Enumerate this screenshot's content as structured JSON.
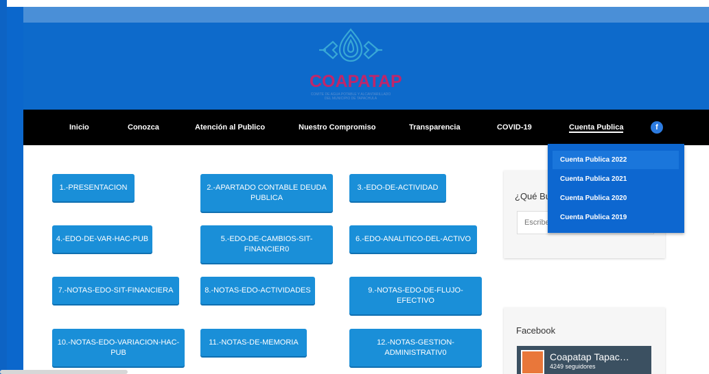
{
  "header": {
    "logo_title": "COAPATAP",
    "logo_subtitle": "COMITE DE AGUA POTABLE Y ALCANTARILLADO DEL MUNICIPIO DE TAPACHULA"
  },
  "nav": {
    "items": [
      {
        "label": "Inicio"
      },
      {
        "label": "Conozca"
      },
      {
        "label": "Atención al Publico"
      },
      {
        "label": "Nuestro Compromiso"
      },
      {
        "label": "Transparencia"
      },
      {
        "label": "COVID-19"
      },
      {
        "label": "Cuenta Publica"
      }
    ],
    "facebook_icon": "f"
  },
  "dropdown": {
    "items": [
      {
        "label": "Cuenta Publica 2022"
      },
      {
        "label": "Cuenta Publica 2021"
      },
      {
        "label": "Cuenta Publica 2020"
      },
      {
        "label": "Cuenta Publica 2019"
      }
    ]
  },
  "buttons": [
    {
      "label": "1.-PRESENTACION"
    },
    {
      "label": "2.-APARTADO CONTABLE DEUDA PUBLICA"
    },
    {
      "label": "3.-EDO-DE-ACTIVIDAD"
    },
    {
      "label": "4.-EDO-DE-VAR-HAC-PUB"
    },
    {
      "label": "5.-EDO-DE-CAMBIOS-SIT-FINANCIER0"
    },
    {
      "label": "6.-EDO-ANALITICO-DEL-ACTIVO"
    },
    {
      "label": "7.-NOTAS-EDO-SIT-FINANCIERA"
    },
    {
      "label": "8.-NOTAS-EDO-ACTIVIDADES"
    },
    {
      "label": "9.-NOTAS-EDO-DE-FLUJO-EFECTIVO"
    },
    {
      "label": "10.-NOTAS-EDO-VARIACION-HAC-PUB"
    },
    {
      "label": "11.-NOTAS-DE-MEMORIA"
    },
    {
      "label": "12.-NOTAS-GESTION-ADMINISTRATIV0"
    }
  ],
  "sidebar": {
    "search_title": "¿Qué Bu",
    "search_placeholder": "Escribe",
    "facebook_title": "Facebook",
    "fb_page_name": "Coapatap Tapac…",
    "fb_followers": "4249 seguidores"
  },
  "colors": {
    "brand_blue": "#0b67cc",
    "button_blue": "#1a8fd8",
    "logo_magenta": "#c0266a"
  }
}
